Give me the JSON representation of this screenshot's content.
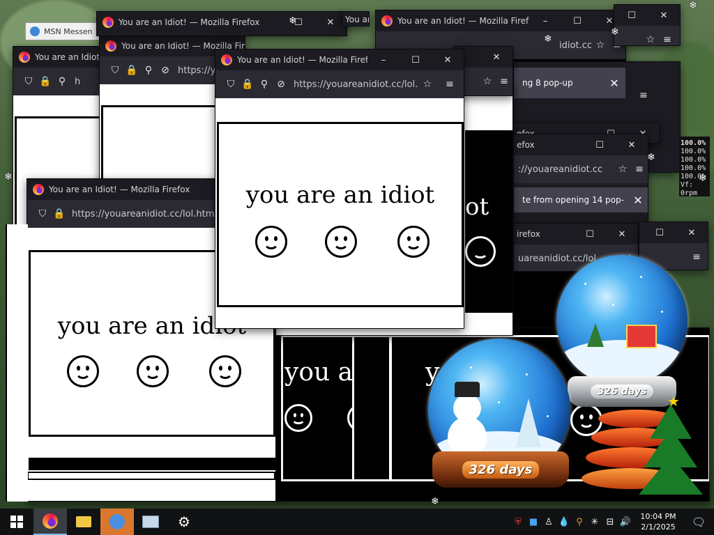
{
  "window_title": "You are an Idiot! — Mozilla Firefox",
  "window_title_short": "You are an Idiot! — Mozilla Firefox",
  "url_full": "https://youareanidiot.cc/lol.html",
  "url_trunc_a": "https://youareanidiot.cc/lol.",
  "url_trunc_b": "://youareanidiot.cc",
  "url_trunc_c": "uareanidiot.cc/lol.",
  "url_trunc_d": "idiot.cc",
  "url_trunc_e": "https://y",
  "url_trunc_f": "h",
  "page_text": "you are an idiot",
  "page_text_partial_a": "you are",
  "page_text_partial_b": "y",
  "page_text_partial_c": "ot",
  "titles_partial": {
    "a": "You are an Idiot! — Mozilla Firefox",
    "b": "You are an Idiot! — Mozilla Firefox",
    "c": "You are an Idiot! — Mozilla Firefox",
    "d": "You are an Idiot! — Mozilla Firefox",
    "e": "efox",
    "f": "efox",
    "g": "irefox",
    "h": "You are a"
  },
  "notifications": {
    "n1": "ng 8 pop-up",
    "n2": "te from opening 14 pop-"
  },
  "msn": "MSN Messen",
  "perf_lines": [
    "100.0%",
    "100.0%",
    "100.0%",
    "100.0%",
    "100.0%",
    "Vf: 0rpm"
  ],
  "globes": {
    "left_label": "326 days",
    "right_label": "326 days"
  },
  "taskbar": {
    "clock_time": "10:04 PM",
    "clock_date": "2/1/2025"
  },
  "icons": {
    "window_min": "–",
    "window_max": "☐",
    "window_close": "✕",
    "shield": "⛉",
    "lock": "🔒",
    "star": "☆",
    "menu": "≡"
  },
  "colors": {
    "chrome_dark": "#1c1b22",
    "toolbar": "#2b2a33",
    "notification": "#42414d",
    "taskbar": "#101214"
  }
}
